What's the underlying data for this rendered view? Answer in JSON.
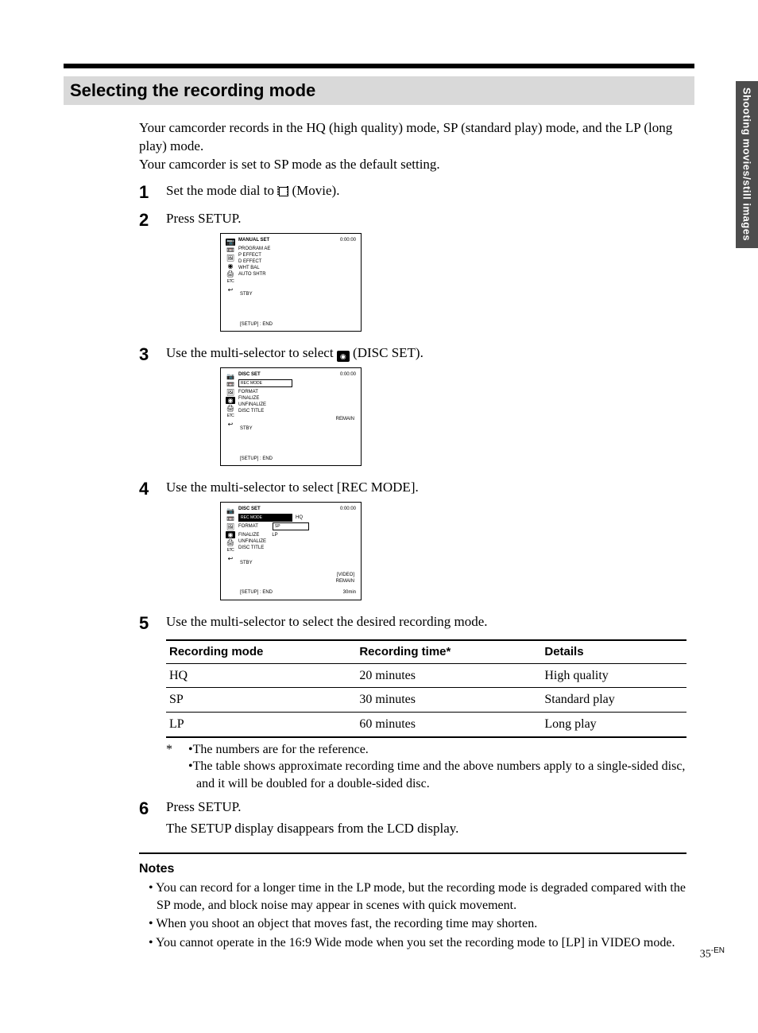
{
  "side_tab": "Shooting movies/still images",
  "page_title": "Selecting the recording mode",
  "intro": {
    "p1": "Your camcorder records in the HQ (high quality) mode, SP (standard play) mode, and the LP (long play) mode.",
    "p2": "Your camcorder is set to SP mode as the default setting."
  },
  "steps": {
    "s1_no": "1",
    "s1_a": "Set the mode dial to ",
    "s1_b": " (Movie).",
    "s2_no": "2",
    "s2": "Press SETUP.",
    "s3_no": "3",
    "s3_a": "Use the multi-selector to select ",
    "s3_b": " (DISC SET).",
    "s4_no": "4",
    "s4": "Use the multi-selector to select [REC MODE].",
    "s5_no": "5",
    "s5": "Use the multi-selector to select the desired recording mode.",
    "s6_no": "6",
    "s6a": "Press SETUP.",
    "s6b": "The SETUP display disappears from the LCD display."
  },
  "screens": {
    "setup_label": "MANUAL SET",
    "progr": "PROGRAM AE",
    "pe": "P EFFECT",
    "de": "D EFFECT",
    "wb": "WHT BAL",
    "ashttr": "AUTO SHTR",
    "stby": "STBY",
    "ret": "[SETUP] : END",
    "clock1": "0:00:00",
    "discset": "DISC SET",
    "recmode": "REC MODE",
    "format": "FORMAT",
    "finalize": "FINALIZE",
    "unfinal": "UNFINALIZE",
    "disctitle": "DISC TITLE",
    "remain": "REMAIN",
    "sp_tag": "SP",
    "sp_val": "SP",
    "hq_opt": "HQ",
    "lp_opt": "LP",
    "vidrem": "[VIDEO]\nREMAIN",
    "timerem1": "30min",
    "timerem2": "30min"
  },
  "table": {
    "h1": "Recording mode",
    "h2": "Recording time*",
    "h3": "Details",
    "rows": [
      {
        "mode": "HQ",
        "time": "20 minutes",
        "detail": "High quality"
      },
      {
        "mode": "SP",
        "time": "30 minutes",
        "detail": "Standard play"
      },
      {
        "mode": "LP",
        "time": "60 minutes",
        "detail": "Long play"
      }
    ]
  },
  "footnote": {
    "ast": "*",
    "f1": "•The numbers are for the reference.",
    "f2": "•The table shows approximate recording time and the above numbers apply to a single-sided disc, and it will be doubled for a double-sided disc."
  },
  "notes": {
    "head": "Notes",
    "n1": "• You can record for a longer time in the LP mode, but the recording mode is degraded compared with the SP mode, and block noise may appear in scenes with quick movement.",
    "n2": "• When you shoot an object that moves fast, the recording time may shorten.",
    "n3": "• You cannot operate in the 16:9 Wide mode when you set the recording mode to [LP] in VIDEO mode."
  },
  "page_no": {
    "num": "35",
    "suffix": "-EN"
  }
}
